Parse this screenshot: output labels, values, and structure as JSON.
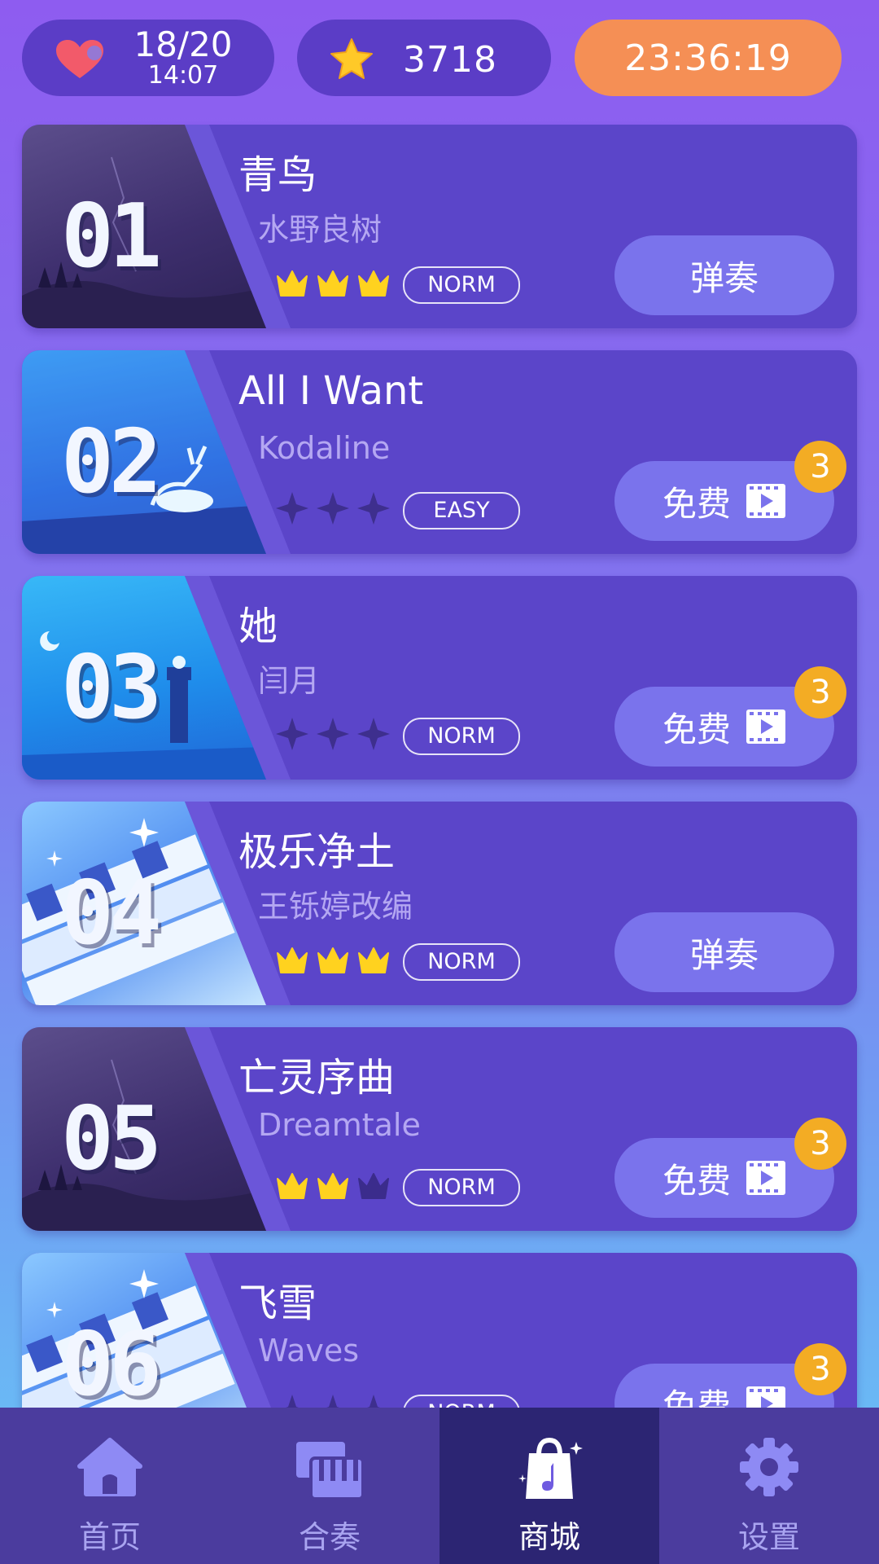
{
  "status": {
    "lives_count": "18/20",
    "lives_timer": "14:07",
    "coins": "3718",
    "countdown": "23:36:19"
  },
  "songs": [
    {
      "num": "01",
      "title": "青鸟",
      "artist": "水野良树",
      "level": "NORM",
      "rating": 3,
      "rating_type": "crown",
      "button": "弹奏",
      "free": false,
      "theme": "dark"
    },
    {
      "num": "02",
      "title": "All I Want",
      "artist": "Kodaline",
      "level": "EASY",
      "rating": 0,
      "rating_type": "star",
      "button": "免费",
      "free": true,
      "badge": "3",
      "theme": "blue"
    },
    {
      "num": "03",
      "title": "她",
      "artist": "闫月",
      "level": "NORM",
      "rating": 0,
      "rating_type": "star",
      "button": "免费",
      "free": true,
      "badge": "3",
      "theme": "cyan"
    },
    {
      "num": "04",
      "title": "极乐净土",
      "artist": "王铄婷改编",
      "level": "NORM",
      "rating": 3,
      "rating_type": "crown",
      "button": "弹奏",
      "free": false,
      "theme": "piano"
    },
    {
      "num": "05",
      "title": "亡灵序曲",
      "artist": "Dreamtale",
      "level": "NORM",
      "rating": 2,
      "rating_type": "crown",
      "button": "免费",
      "free": true,
      "badge": "3",
      "theme": "dark"
    },
    {
      "num": "06",
      "title": "飞雪",
      "artist": "Waves",
      "level": "NORM",
      "rating": 0,
      "rating_type": "star",
      "button": "免费",
      "free": true,
      "badge": "3",
      "theme": "piano"
    }
  ],
  "nav": [
    {
      "label": "首页",
      "icon": "home-icon",
      "active": false
    },
    {
      "label": "合奏",
      "icon": "piano-keys-icon",
      "active": false
    },
    {
      "label": "商城",
      "icon": "shop-bag-icon",
      "active": true
    },
    {
      "label": "设置",
      "icon": "gear-icon",
      "active": false
    }
  ],
  "colors": {
    "accent": "#F58F55",
    "card": "#5B45C9",
    "button": "#7A73EC",
    "badge": "#F3AC24",
    "crown": "#FFD21F"
  }
}
